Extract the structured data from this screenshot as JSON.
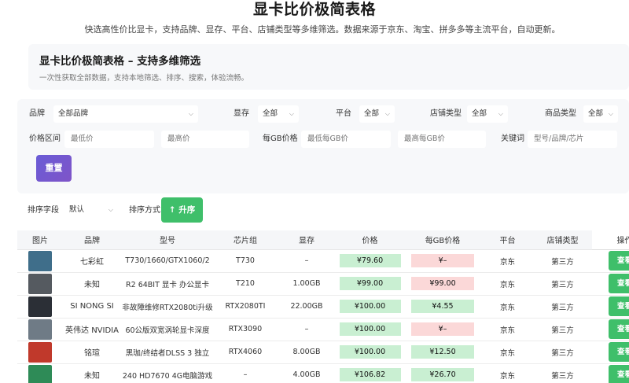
{
  "header": {
    "title": "显卡比价极简表格",
    "subtitle": "快选高性价比显卡，支持品牌、显存、平台、店铺类型等多维筛选。数据来源于京东、淘宝、拼多多等主流平台，自动更新。"
  },
  "info_card": {
    "title": "显卡比价极简表格 – 支持多维筛选",
    "description": "一次性获取全部数据，支持本地筛选、排序、搜索，体验流畅。"
  },
  "filters": {
    "brand_label": "品牌",
    "brand_value": "全部品牌",
    "vram_label": "显存",
    "vram_value": "全部",
    "platform_label": "平台",
    "platform_value": "全部",
    "shop_type_label": "店铺类型",
    "shop_type_value": "全部",
    "product_type_label": "商品类型",
    "product_type_value": "全部",
    "price_range_label": "价格区间",
    "min_price_placeholder": "最低价",
    "max_price_placeholder": "最高价",
    "per_gb_label": "每GB价格",
    "min_per_gb_placeholder": "最低每GB价",
    "max_per_gb_placeholder": "最高每GB价",
    "keyword_label": "关键词",
    "keyword_placeholder": "型号/品牌/芯片",
    "reset_label": "重置"
  },
  "sorting": {
    "field_label": "排序字段",
    "field_value": "默认",
    "order_label": "排序方式",
    "order_button": "↑ 升序"
  },
  "table": {
    "headers": [
      "图片",
      "品牌",
      "型号",
      "芯片组",
      "显存",
      "价格",
      "每GB价格",
      "平台",
      "店铺类型",
      "操作"
    ],
    "rows": [
      {
        "brand": "七彩虹",
        "model": "T730/1660/GTX1060/2",
        "chip": "T730",
        "vram": "–",
        "price": "¥79.60",
        "per_gb": "¥–",
        "per_gb_status": "bad",
        "platform": "京东",
        "shop": "第三方",
        "action": "查看",
        "thumb_color": "#3f6e8a"
      },
      {
        "brand": "未知",
        "model": "R2 64BIT 显卡 办公显卡",
        "chip": "T210",
        "vram": "1.00GB",
        "price": "¥99.00",
        "per_gb": "¥99.00",
        "per_gb_status": "bad",
        "platform": "京东",
        "shop": "第三方",
        "action": "查看",
        "thumb_color": "#555a60"
      },
      {
        "brand": "SI NONG SI",
        "model": "非故障维修RTX2080ti升级",
        "chip": "RTX2080TI",
        "vram": "22.00GB",
        "price": "¥100.00",
        "per_gb": "¥4.55",
        "per_gb_status": "good",
        "platform": "京东",
        "shop": "第三方",
        "action": "查看",
        "thumb_color": "#2b2f36"
      },
      {
        "brand": "英伟达 NVIDIA",
        "model": "60公版双宽涡轮显卡深度",
        "chip": "RTX3090",
        "vram": "–",
        "price": "¥100.00",
        "per_gb": "¥–",
        "per_gb_status": "bad",
        "platform": "京东",
        "shop": "第三方",
        "action": "查看",
        "thumb_color": "#6f7b86"
      },
      {
        "brand": "铭瑄",
        "model": "黑珈/终结者DLSS 3 独立",
        "chip": "RTX4060",
        "vram": "8.00GB",
        "price": "¥100.00",
        "per_gb": "¥12.50",
        "per_gb_status": "good",
        "platform": "京东",
        "shop": "第三方",
        "action": "查看",
        "thumb_color": "#c0392b"
      },
      {
        "brand": "未知",
        "model": "240 HD7670 4G电脑游戏",
        "chip": "–",
        "vram": "4.00GB",
        "price": "¥106.82",
        "per_gb": "¥26.70",
        "per_gb_status": "good",
        "platform": "京东",
        "shop": "第三方",
        "action": "查看",
        "thumb_color": "#2e8b57"
      }
    ]
  }
}
